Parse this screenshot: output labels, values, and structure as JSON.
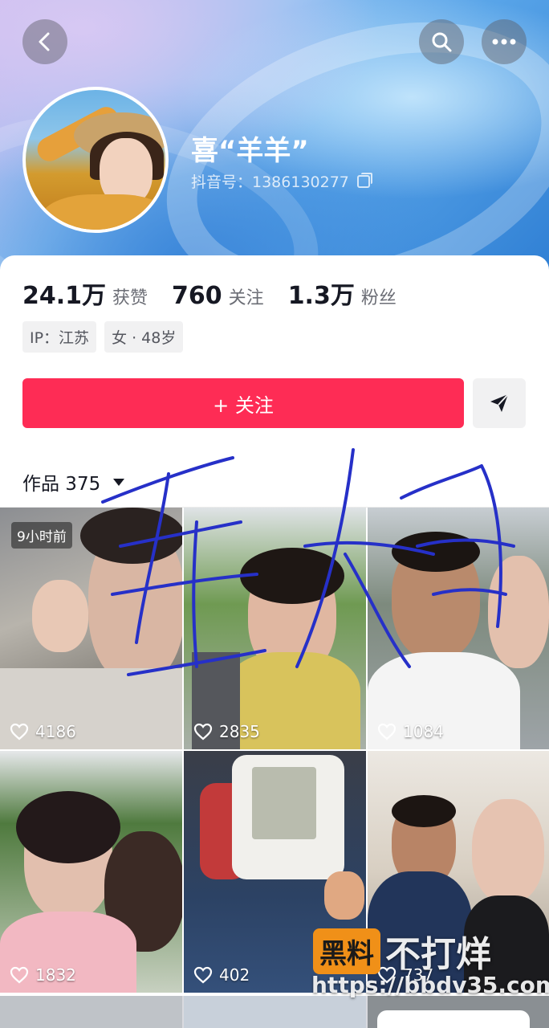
{
  "header": {
    "back_icon": "back-arrow-icon",
    "search_icon": "search-icon",
    "more_icon": "more-dots-icon"
  },
  "profile": {
    "nickname": "喜“羊羊”",
    "douyin_id_label": "抖音号：1386130277",
    "avatar_icon": "avatar-photo"
  },
  "stats": [
    {
      "num": "24.1万",
      "label": "获赞"
    },
    {
      "num": "760",
      "label": "关注"
    },
    {
      "num": "1.3万",
      "label": "粉丝"
    }
  ],
  "tags": [
    "IP：江苏",
    "女 · 48岁"
  ],
  "actions": {
    "follow_label": "+ 关注",
    "message_icon": "send-message-icon"
  },
  "works": {
    "label": "作品 375"
  },
  "grid": [
    {
      "likes": "4186",
      "badge": "9小时前"
    },
    {
      "likes": "2835"
    },
    {
      "likes": "1084"
    },
    {
      "likes": "1832"
    },
    {
      "likes": "402"
    },
    {
      "likes": "737"
    }
  ],
  "overlay": {
    "watermark_box": "黑料",
    "watermark_text": "不打烊",
    "watermark_url": "https://bbdv35.com"
  },
  "colors": {
    "accent": "#fe2c55",
    "watermark": "#f09018"
  }
}
